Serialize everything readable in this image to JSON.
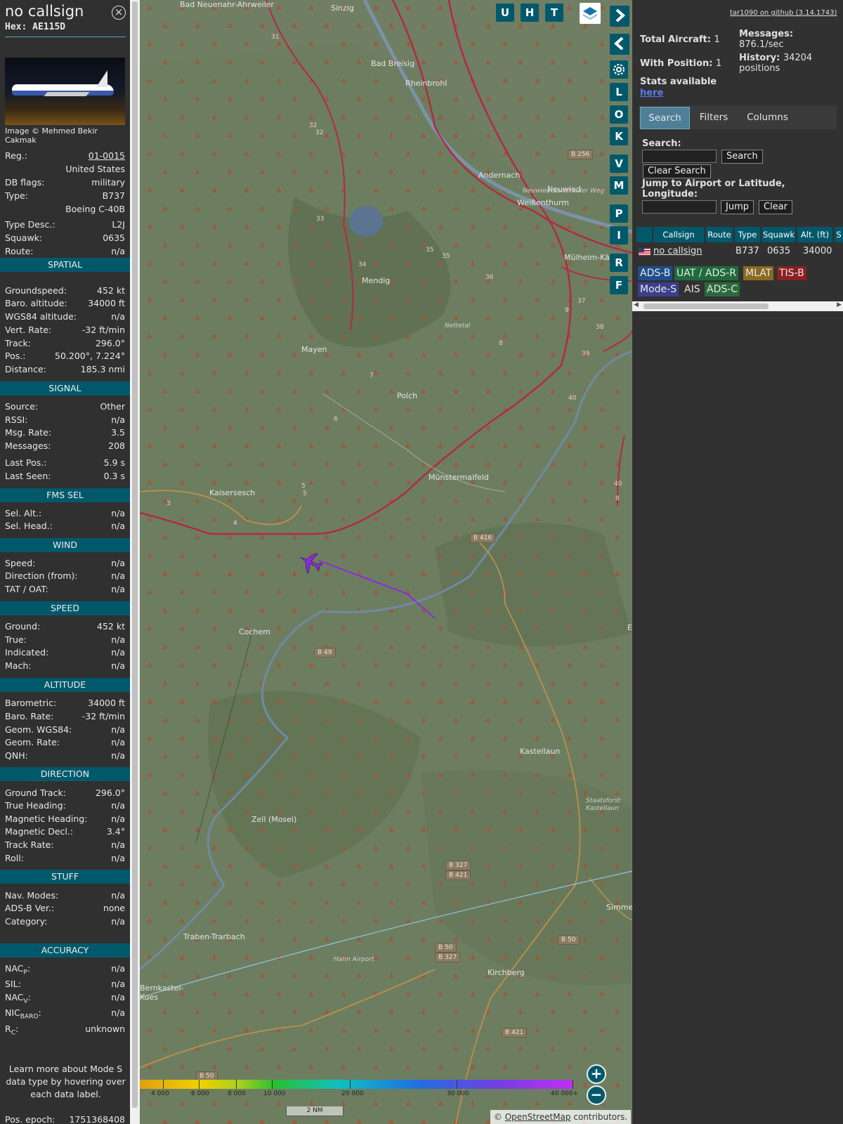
{
  "header": {
    "callsign": "no callsign",
    "hex": "Hex: AE115D"
  },
  "photo": {
    "credit": "Image © Mehmed Bekir Cakmak"
  },
  "info": [
    {
      "k": "Reg.:",
      "v": "01-0015"
    },
    {
      "k": "",
      "v": "United States"
    },
    {
      "k": "DB flags:",
      "v": "military"
    },
    {
      "k": "Type:",
      "v": "B737"
    },
    {
      "k": "",
      "v": "Boeing C-40B"
    },
    {
      "k": "Type Desc.:",
      "v": "L2J"
    },
    {
      "k": "Squawk:",
      "v": "0635"
    },
    {
      "k": "Route:",
      "v": "n/a"
    }
  ],
  "sections": {
    "spatial": {
      "title": "SPATIAL",
      "rows": [
        {
          "k": "Groundspeed:",
          "v": "452 kt"
        },
        {
          "k": "Baro. altitude:",
          "v": "34000 ft"
        },
        {
          "k": "WGS84 altitude:",
          "v": "n/a"
        },
        {
          "k": "Vert. Rate:",
          "v": "-32 ft/min"
        },
        {
          "k": "Track:",
          "v": "296.0°"
        },
        {
          "k": "Pos.:",
          "v": "50.200°, 7.224°"
        },
        {
          "k": "Distance:",
          "v": "185.3 nmi"
        }
      ]
    },
    "signal": {
      "title": "SIGNAL",
      "rows": [
        {
          "k": "Source:",
          "v": "Other"
        },
        {
          "k": "RSSI:",
          "v": "n/a"
        },
        {
          "k": "Msg. Rate:",
          "v": "3.5"
        },
        {
          "k": "Messages:",
          "v": "208"
        },
        {
          "k": "Last Pos.:",
          "v": "5.9 s"
        },
        {
          "k": "Last Seen:",
          "v": "0.3 s"
        }
      ]
    },
    "fms": {
      "title": "FMS SEL",
      "rows": [
        {
          "k": "Sel. Alt.:",
          "v": "n/a"
        },
        {
          "k": "Sel. Head.:",
          "v": "n/a"
        }
      ]
    },
    "wind": {
      "title": "WIND",
      "rows": [
        {
          "k": "Speed:",
          "v": "n/a"
        },
        {
          "k": "Direction (from):",
          "v": "n/a"
        },
        {
          "k": "TAT / OAT:",
          "v": "n/a"
        }
      ]
    },
    "speed": {
      "title": "SPEED",
      "rows": [
        {
          "k": "Ground:",
          "v": "452 kt"
        },
        {
          "k": "True:",
          "v": "n/a"
        },
        {
          "k": "Indicated:",
          "v": "n/a"
        },
        {
          "k": "Mach:",
          "v": "n/a"
        }
      ]
    },
    "altitude": {
      "title": "ALTITUDE",
      "rows": [
        {
          "k": "Barometric:",
          "v": "34000 ft"
        },
        {
          "k": "Baro. Rate:",
          "v": "-32 ft/min"
        },
        {
          "k": "Geom. WGS84:",
          "v": "n/a"
        },
        {
          "k": "Geom. Rate:",
          "v": "n/a"
        },
        {
          "k": "QNH:",
          "v": "n/a"
        }
      ]
    },
    "direction": {
      "title": "DIRECTION",
      "rows": [
        {
          "k": "Ground Track:",
          "v": "296.0°"
        },
        {
          "k": "True Heading:",
          "v": "n/a"
        },
        {
          "k": "Magnetic Heading:",
          "v": "n/a"
        },
        {
          "k": "Magnetic Decl.:",
          "v": "3.4°"
        },
        {
          "k": "Track Rate:",
          "v": "n/a"
        },
        {
          "k": "Roll:",
          "v": "n/a"
        }
      ]
    },
    "stuff": {
      "title": "STUFF",
      "rows": [
        {
          "k": "Nav. Modes:",
          "v": "n/a"
        },
        {
          "k": "ADS-B Ver.:",
          "v": "none"
        },
        {
          "k": "Category:",
          "v": "n/a"
        }
      ]
    },
    "accuracy": {
      "title": "ACCURACY",
      "rows": [
        {
          "k": "NAC",
          "sub": "P",
          "v": "n/a"
        },
        {
          "k": "SIL:",
          "sub": "",
          "v": "n/a"
        },
        {
          "k": "NAC",
          "sub": "V",
          "v": "n/a"
        },
        {
          "k": "NIC",
          "sub": "BARO",
          "v": "n/a"
        },
        {
          "k": "R",
          "sub": "C",
          "v": "unknown"
        }
      ]
    }
  },
  "note": "Learn more about Mode S data type by hovering over each data label.",
  "epoch": {
    "k": "Pos. epoch:",
    "v": "1751368408"
  },
  "map": {
    "buttons": [
      "U",
      "H",
      "T"
    ],
    "side_buttons": [
      "L",
      "O",
      "K",
      "V",
      "M",
      "P",
      "I",
      "R",
      "F"
    ],
    "towns": [
      "Bad Neuenahr-Ahrweiler",
      "Sinzig",
      "Bad Breisig",
      "Rheinbrohl",
      "Andernach",
      "Neuwied",
      "Weißenthurm",
      "Neuwied-Sandkauler Weg",
      "Mülheim-Kä",
      "Mendig",
      "Mayen",
      "Polch",
      "Nettetal",
      "Kaisersesch",
      "Münstermaifeld",
      "Cochem",
      "Kastellaun",
      "Staatsforst Kastellaun",
      "Zell (Mosel)",
      "Traben-Trarbach",
      "Hahn Airport",
      "Kirchberg",
      "Bernkastel-Kues",
      "Simme",
      "E"
    ],
    "road_labels": [
      "B 256",
      "B 416",
      "B 49",
      "B 327",
      "B 421",
      "B 50",
      "B 50",
      "B 327",
      "B 421",
      "B 50"
    ],
    "road_numbers": [
      "31",
      "32",
      "32",
      "33",
      "34",
      "35",
      "35",
      "36",
      "37",
      "9",
      "38",
      "39",
      "40",
      "40",
      "8",
      "8",
      "7",
      "6",
      "5",
      "5",
      "4",
      "3"
    ],
    "scale": "2 NM",
    "attribution_prefix": "© ",
    "attribution_link": "OpenStreetMap",
    "attribution_suffix": " contributors.",
    "color_scale": [
      "4 000",
      "6 000",
      "8 000",
      "10 000",
      "20 000",
      "30 000",
      "40 000+"
    ],
    "zoom_in": "+",
    "zoom_out": "−"
  },
  "right": {
    "github": "tar1090 on github (3.14.1743)",
    "total_label": "Total Aircraft:",
    "total_value": "1",
    "withpos_label": "With Position:",
    "withpos_value": "1",
    "stats_label": "Stats available",
    "stats_link": "here",
    "messages_label": "Messages:",
    "messages_value": "876.1/sec",
    "history_label": "History:",
    "history_value": "34204",
    "history_unit": "positions",
    "tabs": [
      "Search",
      "Filters",
      "Columns"
    ],
    "search_label": "Search:",
    "search_button": "Search",
    "clear_search_button": "Clear Search",
    "jump_label": "Jump to Airport or Latitude, Longitude:",
    "jump_button": "Jump",
    "clear_button": "Clear",
    "columns": [
      "Callsign",
      "Route",
      "Type",
      "Squawk",
      "Alt. (ft)",
      "S"
    ],
    "row": {
      "callsign": "no callsign",
      "route": "",
      "type": "B737",
      "squawk": "0635",
      "alt": "34000"
    },
    "sources": [
      {
        "label": "ADS-B",
        "color": "#1f4e8a"
      },
      {
        "label": "UAT / ADS-R",
        "color": "#1f6b3c"
      },
      {
        "label": "MLAT",
        "color": "#8a6a1f"
      },
      {
        "label": "TIS-B",
        "color": "#8a2020"
      },
      {
        "label": "Mode-S",
        "color": "#3a3f8a"
      },
      {
        "label": "AIS",
        "color": ""
      },
      {
        "label": "ADS-C",
        "color": "#2a6a3a"
      }
    ]
  },
  "colors": {
    "accent": "#00596b",
    "track": "#8a2be2"
  }
}
